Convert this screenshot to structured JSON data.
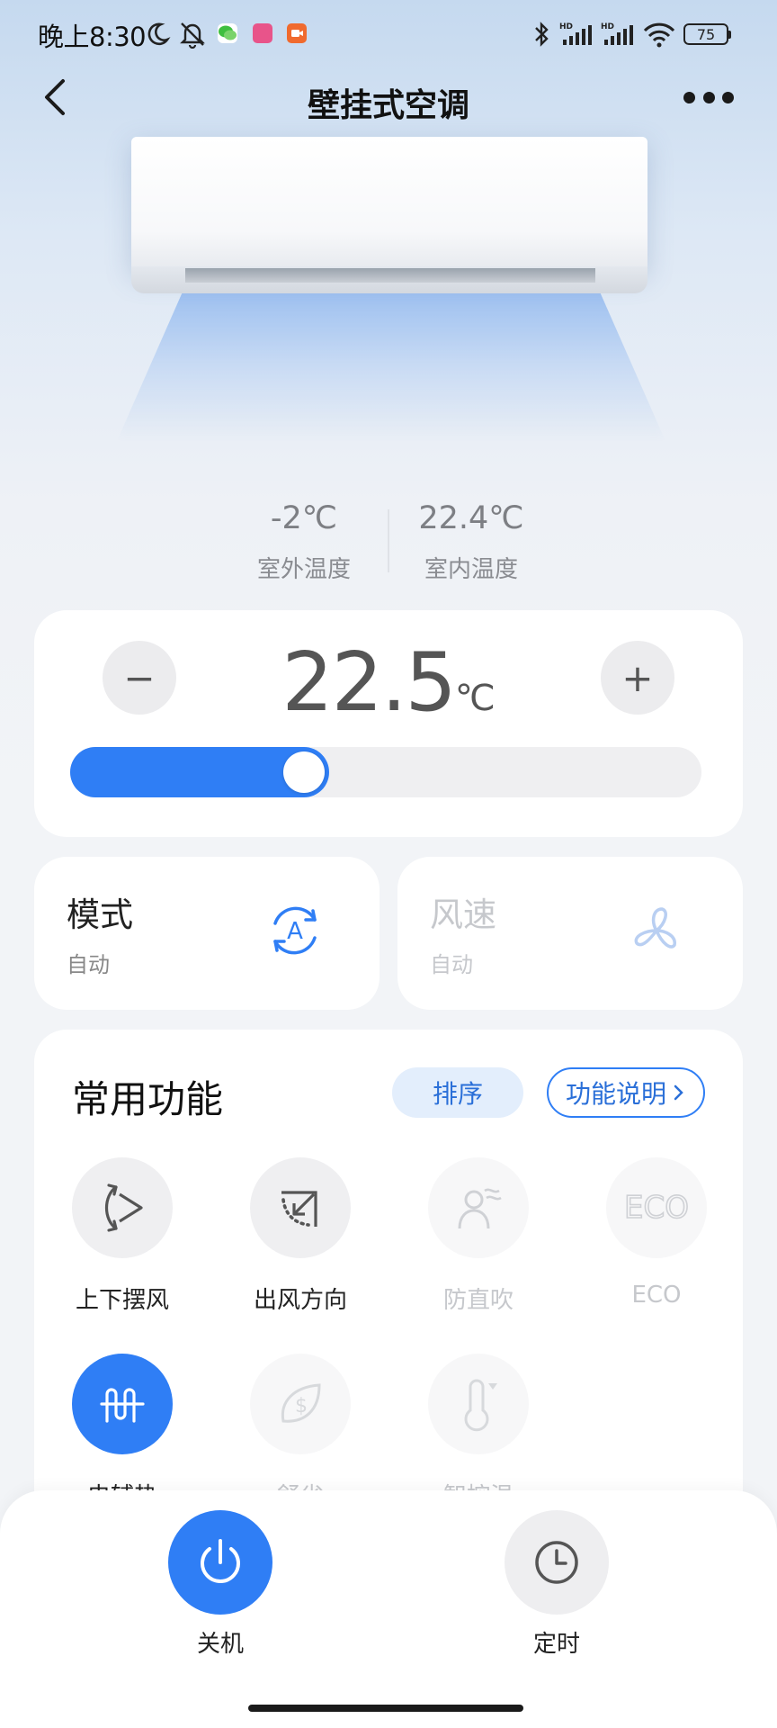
{
  "status_bar": {
    "time": "晚上8:30",
    "battery": "75",
    "icons": [
      "moon-icon",
      "bell-off-icon",
      "wechat-icon",
      "app-icon",
      "video-icon",
      "bluetooth-icon",
      "signal-hd-icon",
      "signal-hd-icon",
      "wifi-icon",
      "battery-icon"
    ]
  },
  "nav": {
    "title": "壁挂式空调",
    "back_icon": "chevron-left-icon",
    "more_icon": "more-dots-icon"
  },
  "temperatures": {
    "outdoor_value": "-2℃",
    "outdoor_label": "室外温度",
    "indoor_value": "22.4℃",
    "indoor_label": "室内温度"
  },
  "temp_control": {
    "minus": "−",
    "plus": "+",
    "value": "22.5",
    "unit": "℃",
    "slider_fraction": 0.41,
    "accent": "#2f7ef5"
  },
  "mode_card": {
    "title": "模式",
    "value": "自动",
    "icon": "auto-mode-icon"
  },
  "fan_card": {
    "title": "风速",
    "value": "自动",
    "icon": "fan-icon"
  },
  "functions": {
    "title": "常用功能",
    "sort_label": "排序",
    "explain_label": "功能说明",
    "items": [
      {
        "label": "上下摆风",
        "icon": "vertical-swing-icon",
        "state": "normal"
      },
      {
        "label": "出风方向",
        "icon": "air-direction-icon",
        "state": "normal"
      },
      {
        "label": "防直吹",
        "icon": "anti-direct-blow-icon",
        "state": "disabled"
      },
      {
        "label": "ECO",
        "icon": "eco-icon",
        "state": "disabled"
      },
      {
        "label": "电辅热",
        "icon": "electric-heat-icon",
        "state": "active"
      },
      {
        "label": "舒省",
        "icon": "save-money-icon",
        "state": "disabled"
      },
      {
        "label": "智控温",
        "icon": "thermometer-icon",
        "state": "disabled"
      }
    ]
  },
  "bottom": {
    "power_label": "关机",
    "timer_label": "定时"
  }
}
